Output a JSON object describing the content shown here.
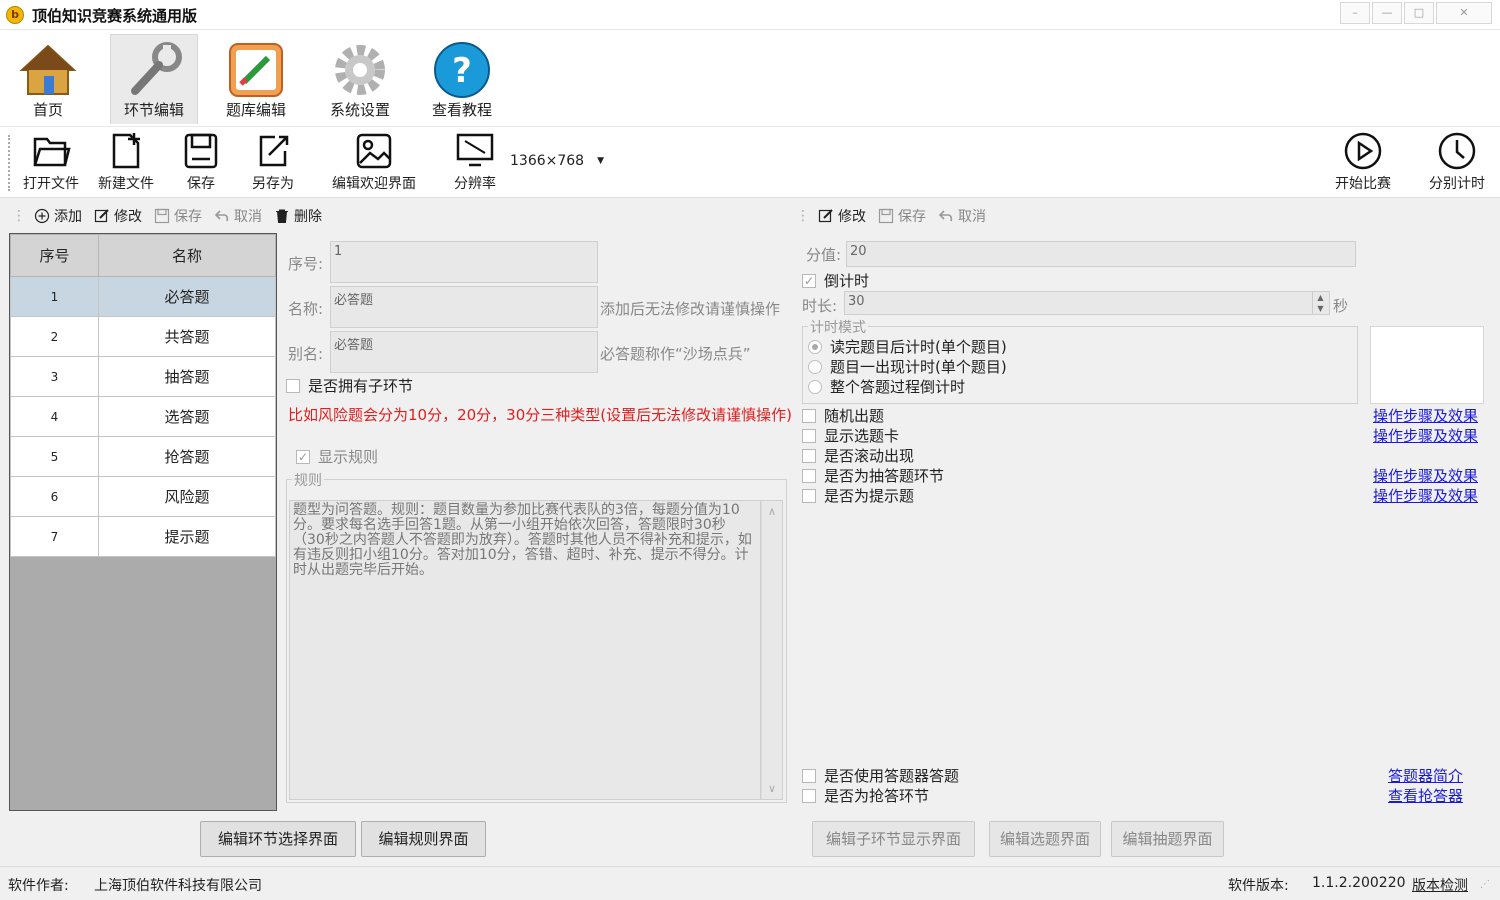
{
  "window": {
    "title": "顶伯知识竞赛系统通用版",
    "logo_char": "b"
  },
  "ribbon_tabs": [
    {
      "label": "首页"
    },
    {
      "label": "环节编辑"
    },
    {
      "label": "题库编辑"
    },
    {
      "label": "系统设置"
    },
    {
      "label": "查看教程"
    }
  ],
  "toolbar": {
    "open": "打开文件",
    "new": "新建文件",
    "save": "保存",
    "save_as": "另存为",
    "edit_welcome": "编辑欢迎界面",
    "resolution": "分辨率",
    "resolution_value": "1366×768",
    "start_match": "开始比赛",
    "timer": "分别计时"
  },
  "left_actions": {
    "add": "添加",
    "edit": "修改",
    "save": "保存",
    "cancel": "取消",
    "delete": "删除"
  },
  "right_actions": {
    "edit": "修改",
    "save": "保存",
    "cancel": "取消"
  },
  "grid": {
    "headers": [
      "序号",
      "名称"
    ],
    "rows": [
      {
        "num": "1",
        "name": "必答题"
      },
      {
        "num": "2",
        "name": "共答题"
      },
      {
        "num": "3",
        "name": "抽答题"
      },
      {
        "num": "4",
        "name": "选答题"
      },
      {
        "num": "5",
        "name": "抢答题"
      },
      {
        "num": "6",
        "name": "风险题"
      },
      {
        "num": "7",
        "name": "提示题"
      }
    ]
  },
  "form": {
    "seq_label": "序号:",
    "seq_value": "1",
    "name_label": "名称:",
    "name_value": "必答题",
    "name_hint": "添加后无法修改请谨慎操作",
    "alias_label": "别名:",
    "alias_value": "必答题",
    "alias_hint": "必答题称作“沙场点兵”",
    "has_sub": "是否拥有子环节",
    "risk_note": "比如风险题会分为10分，20分，30分三种类型(设置后无法修改请谨慎操作)",
    "show_rules": "显示规则",
    "rules_legend": "规则",
    "rules_text": "题型为问答题。规则：题目数量为参加比赛代表队的3倍，每题分值为10分。要求每名选手回答1题。从第一小组开始依次回答，答题限时30秒（30秒之内答题人不答题即为放弃）。答题时其他人员不得补充和提示，如有违反则扣小组10分。答对加10分，答错、超时、补充、提示不得分。计时从出题完毕后开始。"
  },
  "right": {
    "score_label": "分值:",
    "score_value": "20",
    "countdown": "倒计时",
    "duration_label": "时长:",
    "duration_value": "30",
    "duration_unit": "秒",
    "mode_legend": "计时模式",
    "modes": [
      "读完题目后计时(单个题目)",
      "题目一出现计时(单个题目)",
      "整个答题过程倒计时"
    ],
    "options": [
      "随机出题",
      "显示选题卡",
      "是否滚动出现",
      "是否为抽答题环节",
      "是否为提示题"
    ],
    "links": [
      "操作步骤及效果",
      "操作步骤及效果",
      "操作步骤及效果",
      "操作步骤及效果"
    ],
    "bottom_options": [
      "是否使用答题器答题",
      "是否为抢答环节"
    ],
    "bottom_links": [
      "答题器简介",
      "查看抢答器"
    ]
  },
  "buttons": {
    "edit_select": "编辑环节选择界面",
    "edit_rules": "编辑规则界面",
    "edit_sub": "编辑子环节显示界面",
    "edit_pick": "编辑选题界面",
    "edit_draw": "编辑抽题界面"
  },
  "status": {
    "author_label": "软件作者:",
    "author": "上海顶伯软件科技有限公司",
    "version_label": "软件版本:",
    "version": "1.1.2.200220",
    "check": "版本检测"
  }
}
